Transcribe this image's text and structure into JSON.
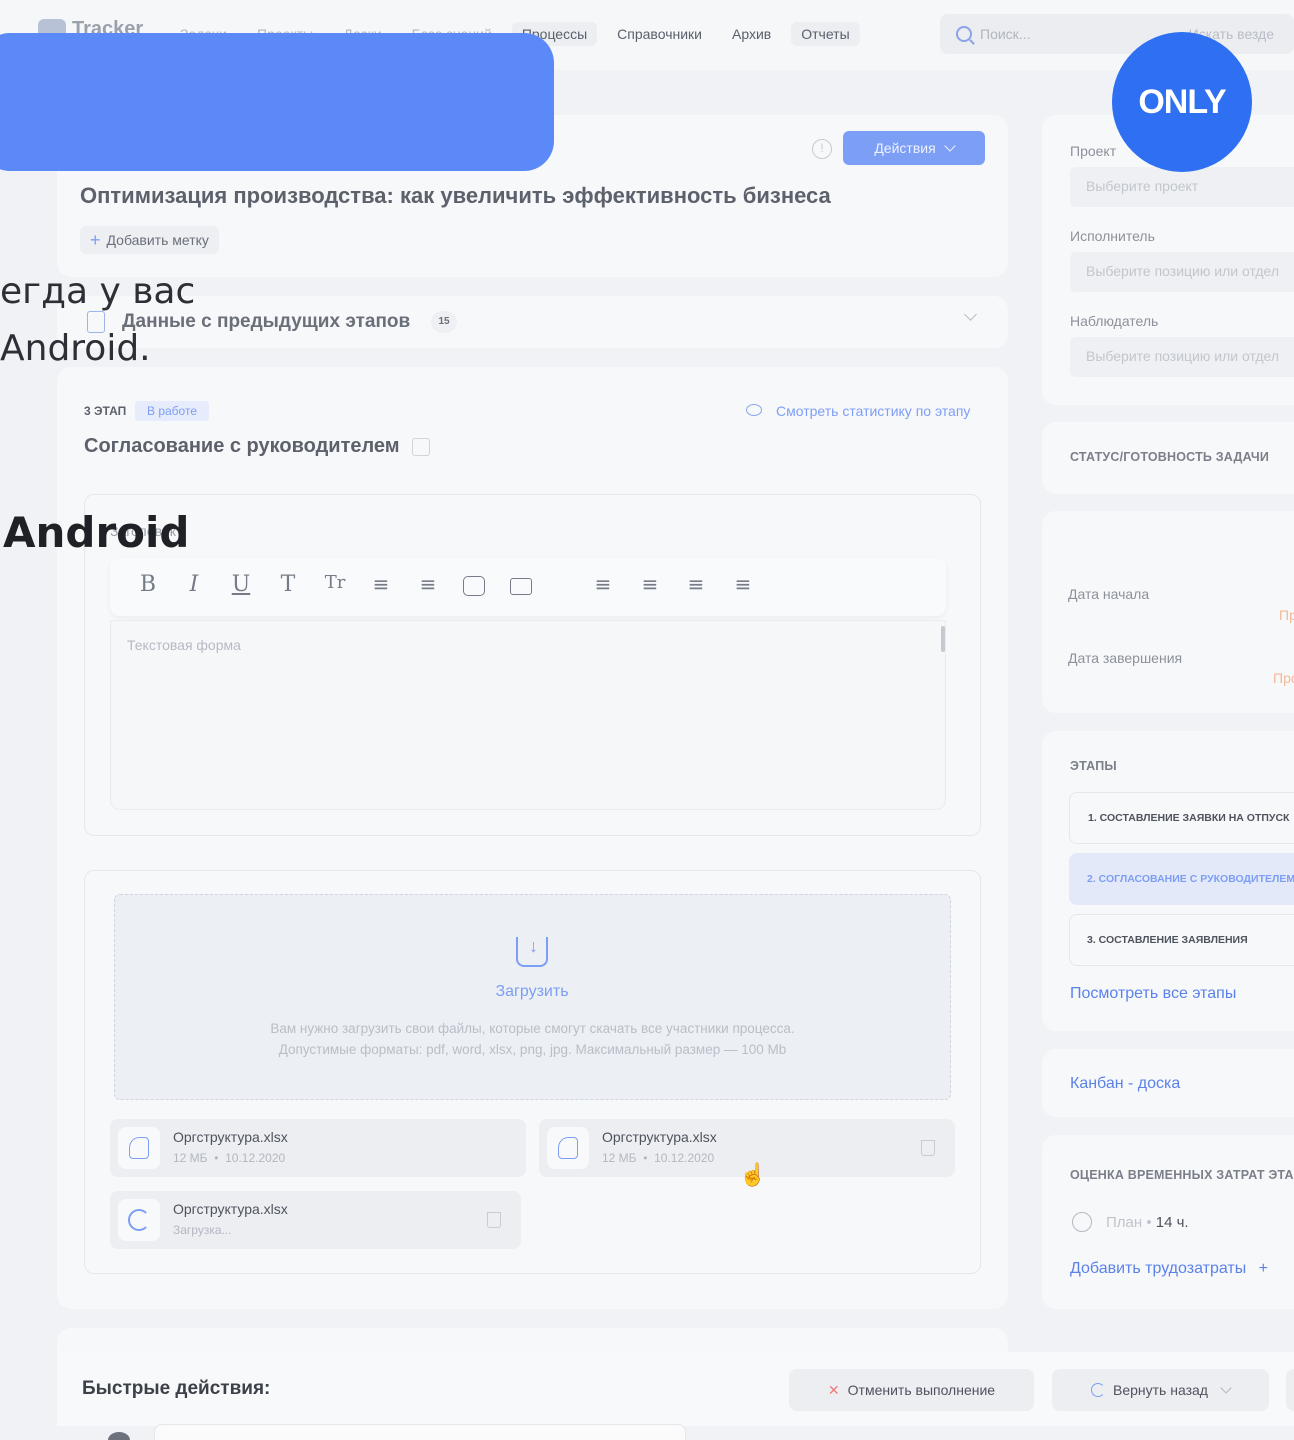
{
  "nav": {
    "logo": "Tracker",
    "links": [
      "Задачи",
      "Проекты",
      "Доски",
      "База знаний",
      "Процессы",
      "Справочники",
      "Архив",
      "Отчеты"
    ],
    "search_placeholder": "Поиск...",
    "search_scope": "Искать везде"
  },
  "overlay": {
    "badge": "ONLY",
    "line1": "егда у вас",
    "line2": "Android.",
    "heading": "Android"
  },
  "task": {
    "actions_label": "Действия",
    "title": "Оптимизация производства: как увеличить эффективность бизнеса",
    "add_tag": "Добавить метку"
  },
  "previous": {
    "label": "Данные с предыдущих этапов",
    "count": "15"
  },
  "stage": {
    "number": "3 ЭТАП",
    "status": "В работе",
    "stats_link": "Смотреть статистику по этапу",
    "title": "Согласование с руководителем",
    "editor_label": "Заголовок",
    "toolbar": [
      "B",
      "I",
      "U",
      "T",
      "Tr",
      "≡",
      "≡",
      "img",
      "vid",
      "≡",
      "≡",
      "≡",
      "≡"
    ],
    "textarea_placeholder": "Текстовая форма",
    "upload_label": "Загрузить",
    "upload_help_1": "Вам нужно загрузить свои файлы, которые смогут скачать все участники процесса.",
    "upload_help_2": "Допустимые форматы: pdf, word, xlsx, png, jpg.  Максимальный размер — 100 Mb",
    "files": [
      {
        "name": "Оргструктура.xlsx",
        "size": "12 МБ",
        "date": "10.12.2020"
      },
      {
        "name": "Оргструктура.xlsx",
        "size": "12 МБ",
        "date": "10.12.2020"
      },
      {
        "name": "Оргструктура.xlsx",
        "status": "Загрузка..."
      }
    ]
  },
  "sidebar": {
    "project_label": "Проект",
    "project_placeholder": "Выберите проект",
    "assignee_label": "Исполнитель",
    "assignee_placeholder": "Выберите позицию или отдел",
    "observer_label": "Наблюдатель",
    "observer_placeholder": "Выберите позицию или отдел",
    "status_title": "СТАТУС/ГОТОВНОСТЬ ЗАДАЧИ",
    "start_label": "Дата начала",
    "start_value": "Пр",
    "end_label": "Дата завершения",
    "end_value": "Про",
    "stages_title": "ЭТАПЫ",
    "stages": [
      "1. СОСТАВЛЕНИЕ ЗАЯВКИ НА ОТПУСК",
      "2. СОГЛАСОВАНИЕ С РУКОВОДИТЕЛЕМ",
      "3. СОСТАВЛЕНИЕ ЗАЯВЛЕНИЯ"
    ],
    "all_stages_link": "Посмотреть все этапы",
    "kanban_link": "Канбан - доска",
    "estimate_title": "ОЦЕНКА ВРЕМЕННЫХ ЗАТРАТ ЭТАПА",
    "plan_label": "План",
    "plan_value": "14 ч.",
    "add_time_link": "Добавить трудозатраты"
  },
  "quick": {
    "title": "Быстрые действия:",
    "cancel_label": "Отменить выполнение",
    "revert_label": "Вернуть назад"
  },
  "colors": {
    "accent": "#7d9ef5",
    "banner": "#5b8af8",
    "only_badge": "#2f6ff2",
    "danger": "#f07a7a"
  }
}
